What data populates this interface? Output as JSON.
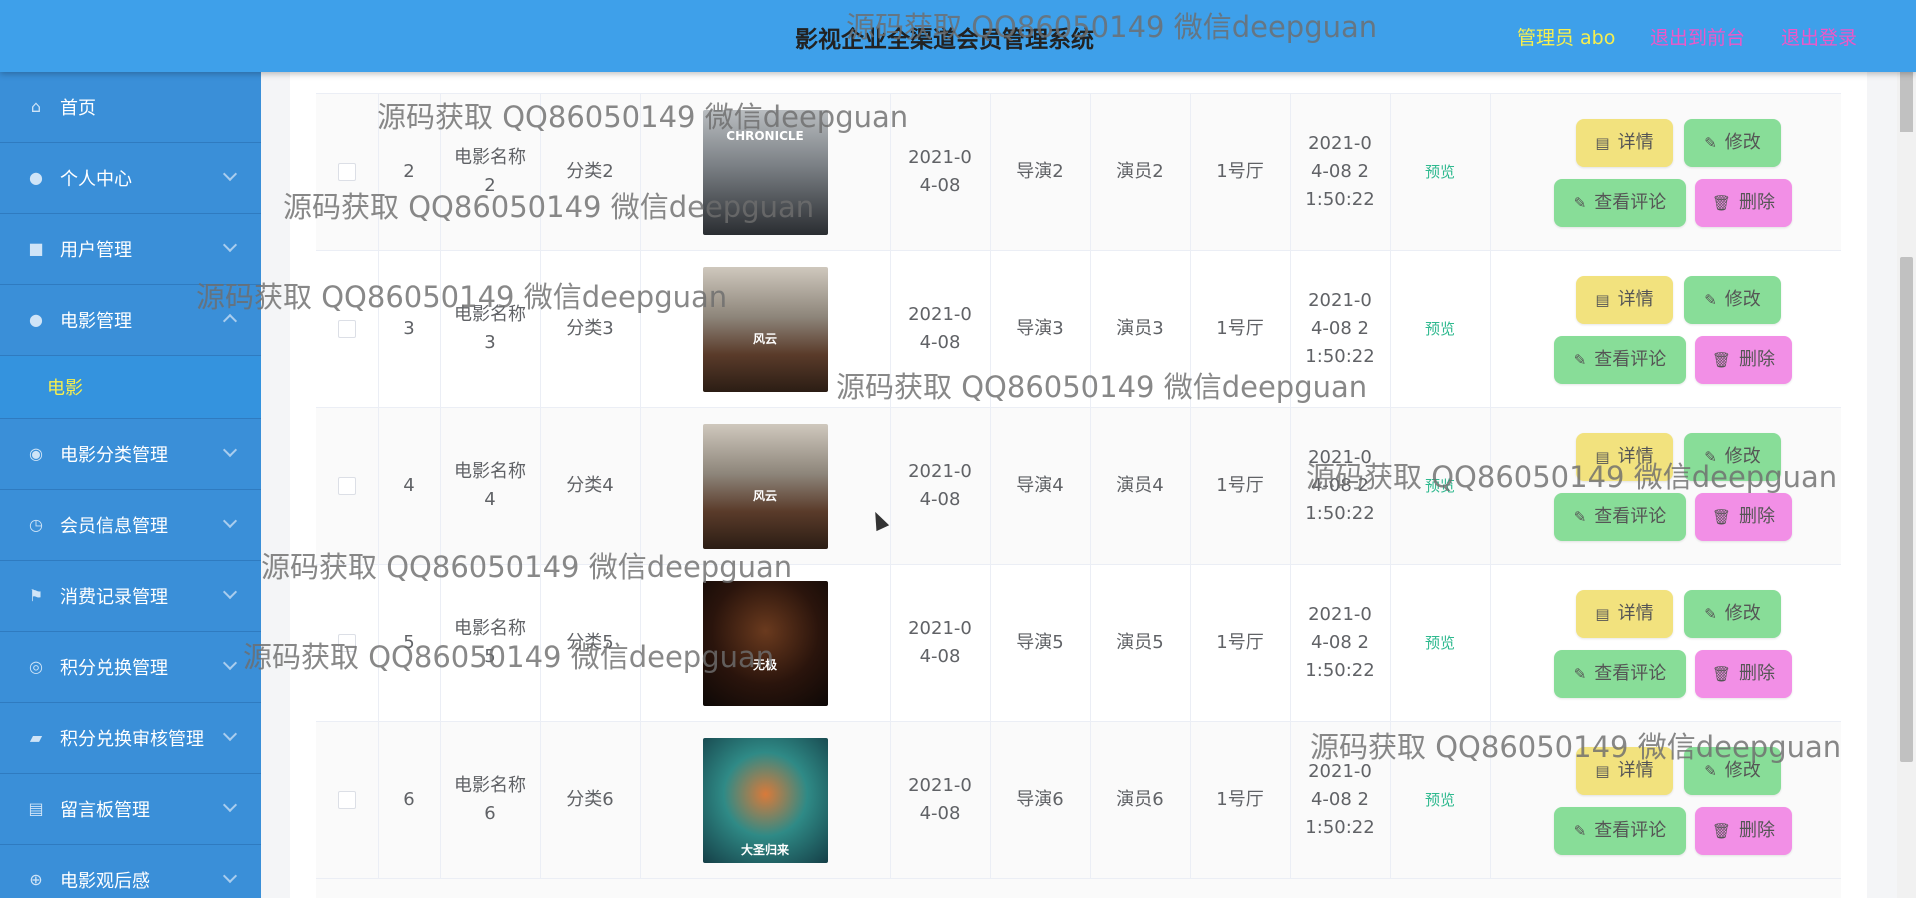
{
  "header": {
    "title": "影视企业全渠道会员管理系统",
    "admin": "管理员 abo",
    "front": "退出到前台",
    "logout": "退出登录"
  },
  "sidebar": {
    "items": [
      {
        "label": "首页",
        "icon": "home-icon"
      },
      {
        "label": "个人中心",
        "icon": "user-icon"
      },
      {
        "label": "用户管理",
        "icon": "chat-icon"
      },
      {
        "label": "电影管理",
        "icon": "user-icon",
        "expanded": true,
        "sub": "电影"
      },
      {
        "label": "电影分类管理",
        "icon": "bulb-icon"
      },
      {
        "label": "会员信息管理",
        "icon": "clock-icon"
      },
      {
        "label": "消费记录管理",
        "icon": "flag-icon"
      },
      {
        "label": "积分兑换管理",
        "icon": "circle-icon"
      },
      {
        "label": "积分兑换审核管理",
        "icon": "briefcase-icon"
      },
      {
        "label": "留言板管理",
        "icon": "chart-icon"
      },
      {
        "label": "电影观后感",
        "icon": "target-icon"
      }
    ]
  },
  "table": {
    "rows": [
      {
        "id": "2",
        "name": "电影名称2",
        "category": "分类2",
        "date": "2021-04-08",
        "director": "导演2",
        "actor": "演员2",
        "hall": "1号厅",
        "time": "2021-04-08 21:50:22",
        "preview": "预览",
        "poster_text": "CHRONICLE"
      },
      {
        "id": "3",
        "name": "电影名称3",
        "category": "分类3",
        "date": "2021-04-08",
        "director": "导演3",
        "actor": "演员3",
        "hall": "1号厅",
        "time": "2021-04-08 21:50:22",
        "preview": "预览",
        "poster_text": "风云"
      },
      {
        "id": "4",
        "name": "电影名称4",
        "category": "分类4",
        "date": "2021-04-08",
        "director": "导演4",
        "actor": "演员4",
        "hall": "1号厅",
        "time": "2021-04-08 21:50:22",
        "preview": "预览",
        "poster_text": "风云"
      },
      {
        "id": "5",
        "name": "电影名称5",
        "category": "分类5",
        "date": "2021-04-08",
        "director": "导演5",
        "actor": "演员5",
        "hall": "1号厅",
        "time": "2021-04-08 21:50:22",
        "preview": "预览",
        "poster_text": "无极"
      },
      {
        "id": "6",
        "name": "电影名称6",
        "category": "分类6",
        "date": "2021-04-08",
        "director": "导演6",
        "actor": "演员6",
        "hall": "1号厅",
        "time": "2021-04-08 21:50:22",
        "preview": "预览",
        "poster_text": "大圣归来"
      }
    ],
    "buttons": {
      "detail": "详情",
      "edit": "修改",
      "comment": "查看评论",
      "delete": "删除"
    }
  },
  "watermark": "源码获取 QQ86050149 微信deepguan"
}
